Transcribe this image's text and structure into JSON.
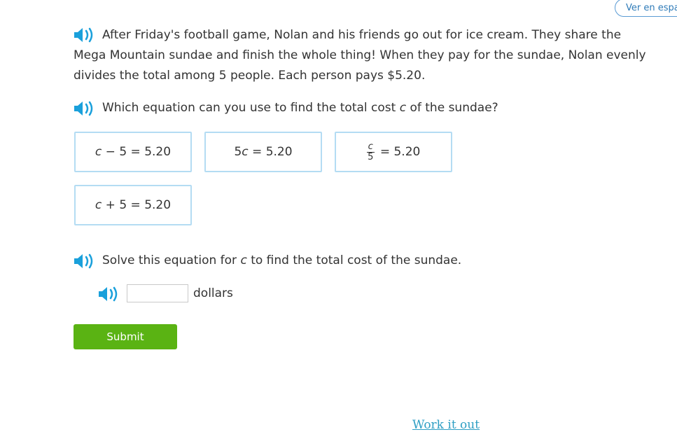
{
  "lang_button": "Ver en español",
  "question": {
    "text": "After Friday's football game, Nolan and his friends go out for ice cream. They share the Mega Mountain sundae and finish the whole thing! When they pay for the sundae, Nolan evenly divides the total among 5 people. Each person pays $5.20."
  },
  "prompt1": {
    "before": "Which equation can you use to find the total cost ",
    "var": "c",
    "after": " of the sundae?"
  },
  "choices": [
    {
      "var": "c",
      "text": " − 5 = 5.20"
    },
    {
      "prefix": "5",
      "var": "c",
      "text": " = 5.20"
    },
    {
      "num": "c",
      "den": "5",
      "text": "= 5.20"
    },
    {
      "var": "c",
      "text": " + 5 = 5.20"
    }
  ],
  "prompt2": {
    "before": "Solve this equation for ",
    "var": "c",
    "after": " to find the total cost of the sundae."
  },
  "answer": {
    "value": "",
    "unit": "dollars"
  },
  "submit_label": "Submit",
  "work_link": "Work it out",
  "colors": {
    "accent": "#1aa0db",
    "submit": "#5ab313",
    "choice_border": "#b4dcf3",
    "link": "#2f9fc4"
  }
}
